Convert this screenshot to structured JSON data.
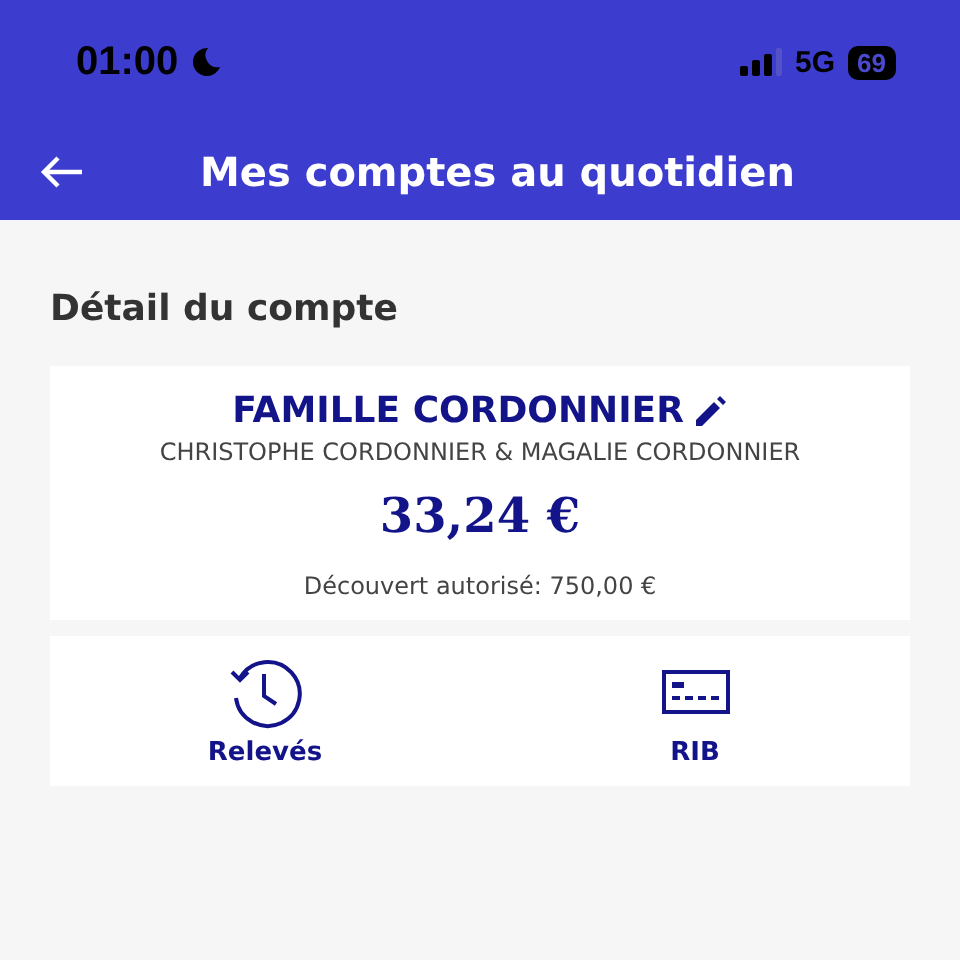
{
  "status_bar": {
    "time": "01:00",
    "network": "5G",
    "battery": "69"
  },
  "header": {
    "title": "Mes comptes au quotidien"
  },
  "section_title": "Détail du compte",
  "account": {
    "name": "FAMILLE CORDONNIER",
    "holders": "CHRISTOPHE CORDONNIER & MAGALIE CORDONNIER",
    "balance": "33,24 €",
    "overdraft": "Découvert autorisé: 750,00 €"
  },
  "actions": [
    {
      "label": "Relevés",
      "kind": "history"
    },
    {
      "label": "RIB",
      "kind": "card"
    }
  ]
}
